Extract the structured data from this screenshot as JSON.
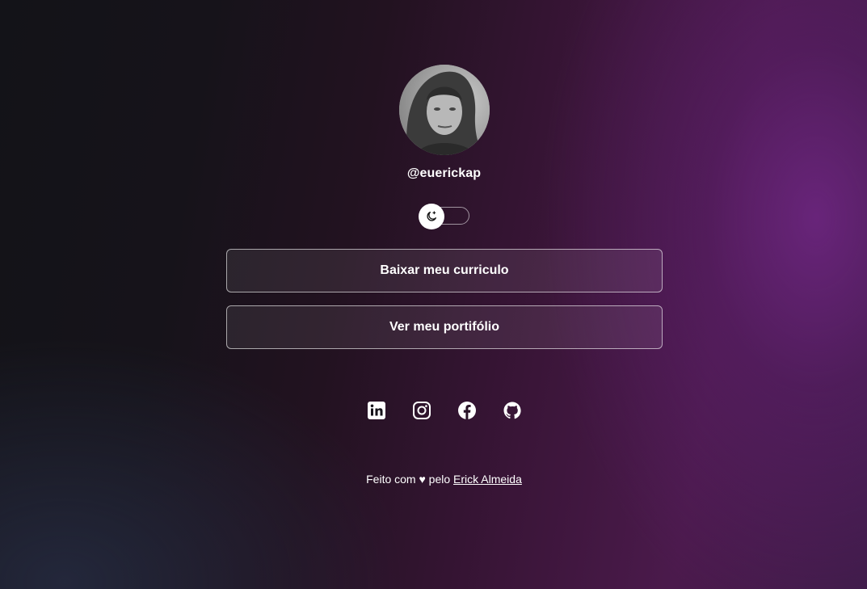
{
  "profile": {
    "username": "@euerickap",
    "avatar_icon": "profile-photo"
  },
  "theme_toggle": {
    "icon": "moon-icon",
    "state": "dark"
  },
  "links": [
    {
      "label": "Baixar meu curriculo"
    },
    {
      "label": "Ver meu portifólio"
    }
  ],
  "social": [
    {
      "icon": "linkedin-icon"
    },
    {
      "icon": "instagram-icon"
    },
    {
      "icon": "facebook-icon"
    },
    {
      "icon": "github-icon"
    }
  ],
  "footer": {
    "prefix": "Feito com ♥ pelo",
    "author": "Erick Almeida"
  },
  "colors": {
    "accent_purple": "#6a2679",
    "text": "#ffffff"
  }
}
